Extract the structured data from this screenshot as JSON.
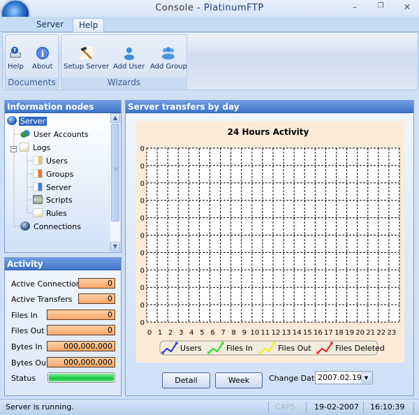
{
  "window": {
    "title_prefix": "Console - ",
    "title_app": "PlatinumFTP",
    "minimize_icon": "–",
    "restore_icon": "❐",
    "close_icon": "✕"
  },
  "ribbon": {
    "tabs": [
      {
        "label": "Server",
        "active": false
      },
      {
        "label": "Help",
        "active": true
      }
    ],
    "groups": [
      {
        "label": "Documents",
        "buttons": [
          {
            "label": "Help",
            "icon": "help-computer-icon"
          },
          {
            "label": "About",
            "icon": "info-icon"
          }
        ]
      },
      {
        "label": "Wizards",
        "buttons": [
          {
            "label": "Setup Server",
            "icon": "hammer-icon"
          },
          {
            "label": "Add User",
            "icon": "user-icon"
          },
          {
            "label": "Add Group",
            "icon": "group-icon"
          }
        ]
      }
    ]
  },
  "info_nodes": {
    "title": "Information nodes",
    "items": [
      {
        "label": "Server",
        "icon": "globe-icon",
        "level": 0,
        "selected": true
      },
      {
        "label": "User Accounts",
        "icon": "user-accounts-icon",
        "level": 1
      },
      {
        "label": "Logs",
        "icon": "logs-folder-icon",
        "level": 1,
        "expanded": true,
        "expander": "−"
      },
      {
        "label": "Users",
        "icon": "log-file-icon",
        "level": 2
      },
      {
        "label": "Groups",
        "icon": "log-file-icon",
        "level": 2
      },
      {
        "label": "Server",
        "icon": "log-file-icon",
        "level": 2
      },
      {
        "label": "Scripts",
        "icon": "script-icon",
        "level": 2
      },
      {
        "label": "Rules",
        "icon": "rules-icon",
        "level": 2
      },
      {
        "label": "Connections",
        "icon": "network-globe-icon",
        "level": 1
      }
    ],
    "scroll_up": "▲",
    "scroll_down": "▼",
    "thumb_grip": "≡"
  },
  "activity": {
    "title": "Activity",
    "rows": [
      {
        "label": "Active Connections",
        "value": "0"
      },
      {
        "label": "Active Transfers",
        "value": "0"
      },
      {
        "label": "Files In",
        "value": "0"
      },
      {
        "label": "Files Out",
        "value": "0"
      },
      {
        "label": "Bytes In",
        "value": "000,000,000"
      },
      {
        "label": "Bytes Out",
        "value": "000,000,000"
      }
    ],
    "status_label": "Status",
    "status_progress": 1.0,
    "status_color": "#16c43b"
  },
  "transfers": {
    "title": "Server transfers by day",
    "detail_button": "Detail",
    "week_button": "Week",
    "change_date_label": "Change Date",
    "date_value": "2007.02.19",
    "dropdown_icon": "▼"
  },
  "chart_data": {
    "type": "line",
    "title": "24 Hours Activity",
    "xlabel": "",
    "ylabel": "",
    "x": [
      0,
      1,
      2,
      3,
      4,
      5,
      6,
      7,
      8,
      9,
      10,
      11,
      12,
      13,
      14,
      15,
      16,
      17,
      18,
      19,
      20,
      21,
      22,
      23
    ],
    "y_tick_labels": [
      "0",
      "0",
      "0",
      "0",
      "0",
      "0",
      "0",
      "0",
      "0",
      "0",
      "0"
    ],
    "ylim": [
      0,
      0
    ],
    "grid": true,
    "legend_position": "bottom",
    "series": [
      {
        "name": "Users",
        "color": "#1a2fe0",
        "values": [
          0,
          0,
          0,
          0,
          0,
          0,
          0,
          0,
          0,
          0,
          0,
          0,
          0,
          0,
          0,
          0,
          0,
          0,
          0,
          0,
          0,
          0,
          0,
          0
        ]
      },
      {
        "name": "Files In",
        "color": "#1ed81e",
        "values": [
          0,
          0,
          0,
          0,
          0,
          0,
          0,
          0,
          0,
          0,
          0,
          0,
          0,
          0,
          0,
          0,
          0,
          0,
          0,
          0,
          0,
          0,
          0,
          0
        ]
      },
      {
        "name": "Files Out",
        "color": "#f2f20a",
        "values": [
          0,
          0,
          0,
          0,
          0,
          0,
          0,
          0,
          0,
          0,
          0,
          0,
          0,
          0,
          0,
          0,
          0,
          0,
          0,
          0,
          0,
          0,
          0,
          0
        ]
      },
      {
        "name": "Files Deleted",
        "color": "#e81c1c",
        "values": [
          0,
          0,
          0,
          0,
          0,
          0,
          0,
          0,
          0,
          0,
          0,
          0,
          0,
          0,
          0,
          0,
          0,
          0,
          0,
          0,
          0,
          0,
          0,
          0
        ]
      }
    ]
  },
  "statusbar": {
    "message": "Server is running.",
    "caps": "CAPS",
    "date": "19-02-2007",
    "time": "16:10:39"
  }
}
